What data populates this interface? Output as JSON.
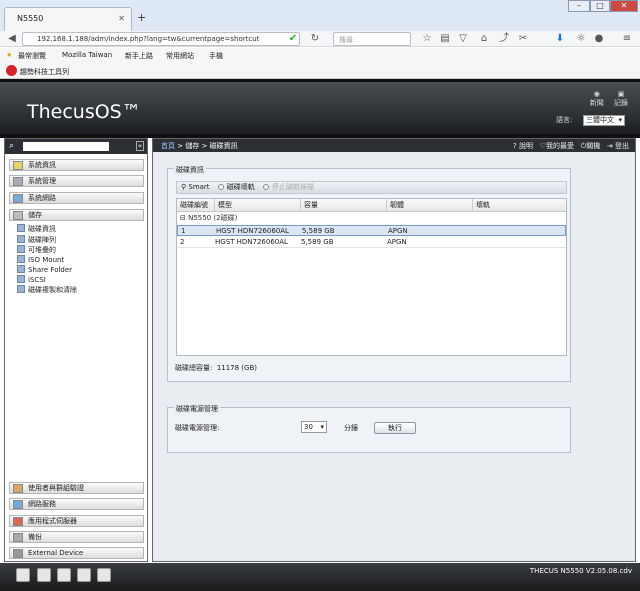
{
  "browser": {
    "tab_title": "N5550",
    "url": "192.168.1.188/adm/index.php?lang=tw&currentpage=shortcut",
    "search_placeholder": "搜尋",
    "bookmarks": [
      "最常瀏覽",
      "Mozilla Taiwan",
      "新手上路",
      "常用網站",
      "手機"
    ],
    "toolbar_text": "趨勢科技工具列"
  },
  "header": {
    "logo": "ThecusOS™",
    "news": "新聞",
    "notes": "記錄",
    "lang_label": "語言:",
    "lang_value": "三體中文"
  },
  "sidebar": {
    "sections": [
      "系統資訊",
      "系統管理",
      "系統網路",
      "儲存"
    ],
    "storage_items": [
      "磁碟資訊",
      "磁碟陣列",
      "可堆疊的",
      "ISO Mount",
      "Share Folder",
      "iSCSI",
      "磁碟複製和清除"
    ],
    "bottom_sections": [
      "使用者與群組驗證",
      "網路服務",
      "應用程式伺服器",
      "備份",
      "External Device"
    ]
  },
  "breadcrumb": {
    "home": "首頁",
    "p1": "儲存",
    "p2": "磁碟資訊"
  },
  "topbar": {
    "help": "說明",
    "fav": "我的最愛",
    "shutdown": "關機",
    "logout": "登出"
  },
  "disk_panel": {
    "title": "磁碟資訊",
    "tool_smart": "Smart",
    "tool_scan": "磁碟壞軌",
    "tool_stop": "停止磁軌掃描",
    "columns": [
      "磁碟編號",
      "模型",
      "容量",
      "韌體",
      "壞軌"
    ],
    "group": "N5550 (2磁碟)",
    "rows": [
      {
        "no": "1",
        "model": "HGST HDN726060AL",
        "cap": "5,589 GB",
        "fw": "APGN"
      },
      {
        "no": "2",
        "model": "HGST HDN726060AL",
        "cap": "5,589 GB",
        "fw": "APGN"
      }
    ],
    "total_label": "磁碟總容量:",
    "total_value": "11178 (GB)"
  },
  "power_panel": {
    "title": "磁碟電源管理",
    "label": "磁碟電源管理:",
    "value": "30",
    "unit": "分鐘",
    "button": "執行"
  },
  "status": {
    "version": "THECUS N5550 V2.05.08.cdv"
  }
}
